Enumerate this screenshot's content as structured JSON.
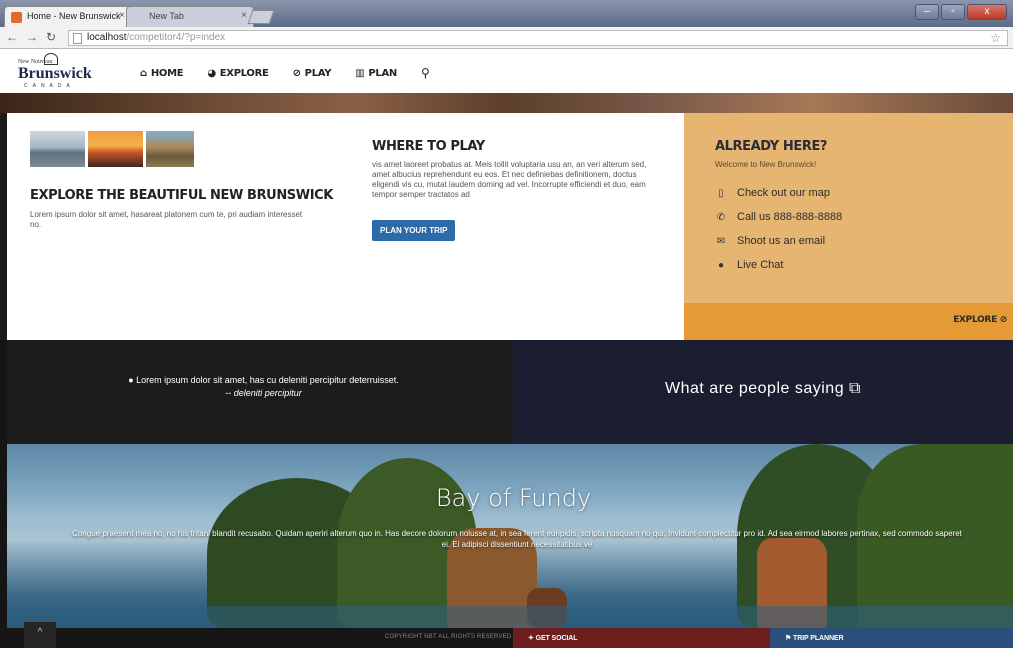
{
  "browser": {
    "tabs": [
      {
        "label": "Home - New Brunswick",
        "close": "×"
      },
      {
        "label": "New Tab",
        "close": "×"
      }
    ],
    "url_host": "localhost",
    "url_path": "/competitor4/?p=index",
    "window_buttons": [
      "–",
      "▫",
      "x"
    ]
  },
  "logo": {
    "top": "New Nouveau",
    "main": "Brunswick",
    "sub": "CANADA"
  },
  "nav": {
    "items": [
      {
        "label": "HOME",
        "icon": "home-icon",
        "glyph": "⌂"
      },
      {
        "label": "EXPLORE",
        "icon": "globe-icon",
        "glyph": "◕"
      },
      {
        "label": "PLAY",
        "icon": "compass-icon",
        "glyph": "⊘"
      },
      {
        "label": "PLAN",
        "icon": "map-icon",
        "glyph": "▥"
      },
      {
        "label": "",
        "icon": "search-icon",
        "glyph": "⚲"
      }
    ]
  },
  "explore_block": {
    "title": "EXPLORE THE BEAUTIFUL NEW BRUNSWICK",
    "text": "Lorem ipsum dolor sit amet, hasareat platonem cum te, pri audiam interesset no."
  },
  "play_block": {
    "title": "WHERE TO PLAY",
    "text": "vis amet laoreet probatus at. Meis tollit voluptaria usu an, an veri alterum sed, amet albucius reprehendunt eu eos. Et nec definiebas definitionem, doctus eligendi vis cu, mutat laudem doming ad vel. Incorrupte efficiendi et duo, eam tempor semper tractatos ad",
    "button": "PLAN YOUR TRIP"
  },
  "here_block": {
    "title": "ALREADY HERE?",
    "welcome": "Welcome to New Brunswick!",
    "contacts": [
      {
        "label": "Check out our map",
        "glyph": "▯"
      },
      {
        "label": "Call us 888-888-8888",
        "glyph": "✆"
      },
      {
        "label": "Shoot us an email",
        "glyph": "✉"
      },
      {
        "label": "Live Chat",
        "glyph": "●"
      }
    ],
    "explore_label": "EXPLORE ⊘"
  },
  "quote": {
    "text": "Lorem ipsum dolor sit amet, has cu deleniti percipitur deterruisset.",
    "author": "-- deleniti percipitur"
  },
  "testimonials": {
    "label": "What are people saying ⧉"
  },
  "hero": {
    "title": "Bay of Fundy",
    "text": "Congue praesent mea no, no his tritani blandit recusabo. Quidam aperiri alterum quo in. Has decore dolorum nolusse at, in sea ferent euripidis, scripta nusquam no qui. Invidunt complectitur pro id. Ad sea eirmod labores pertinax, sed commodo saperet ei. Ei adipisci dissentiunt necessitatibus ve"
  },
  "footer": {
    "totop": "^",
    "copyright": "COPYRIGHT NBT ALL RIGHTS RESERVED",
    "social": "GET SOCIAL",
    "planner": "TRIP PLANNER"
  },
  "colors": {
    "col3_bg": "#e7b572",
    "explore_bar": "#e59a36",
    "button": "#2c6aa8",
    "social": "#6d1f1f",
    "planner": "#2a4f7b"
  }
}
